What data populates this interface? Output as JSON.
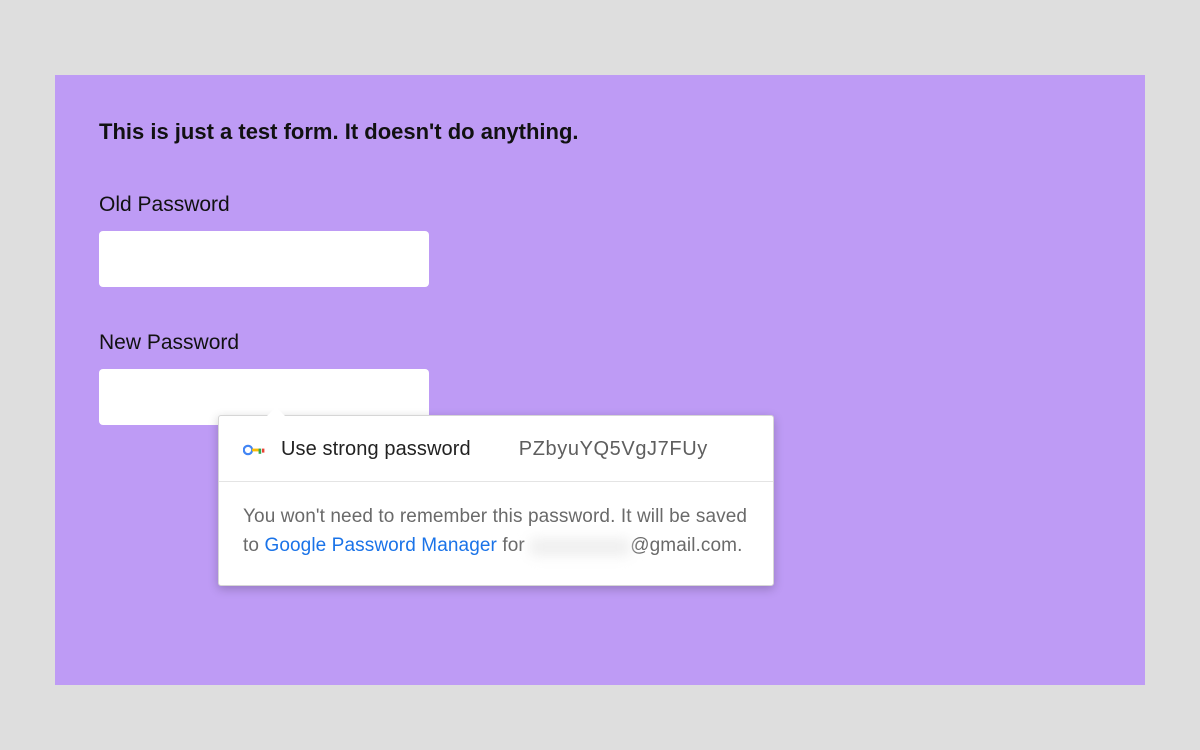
{
  "form": {
    "heading": "This is just a test form. It doesn't do anything.",
    "old_password": {
      "label": "Old Password",
      "value": ""
    },
    "new_password": {
      "label": "New Password",
      "value": ""
    }
  },
  "popup": {
    "action_label": "Use strong password",
    "suggested_password": "PZbyuYQ5VgJ7FUy",
    "info_pre": "You won't need to remember this password. It will be saved to ",
    "link_text": "Google Password Manager",
    "info_mid": " for ",
    "email_visible_part": "@gmail.com."
  }
}
